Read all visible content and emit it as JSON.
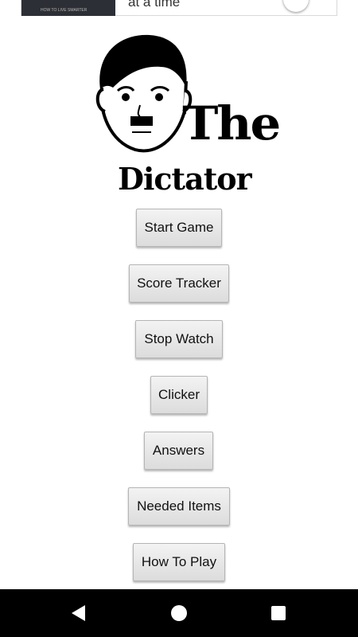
{
  "ad": {
    "thumb_caption": "HOW TO LIVE SMARTER",
    "text": "at a time"
  },
  "logo": {
    "title_the": "The",
    "title_dictator": "Dictator"
  },
  "menu": {
    "items": [
      {
        "label": "Start Game"
      },
      {
        "label": "Score Tracker"
      },
      {
        "label": "Stop Watch"
      },
      {
        "label": "Clicker"
      },
      {
        "label": "Answers"
      },
      {
        "label": "Needed Items"
      },
      {
        "label": "How To Play"
      }
    ]
  },
  "navbar": {
    "back_icon": "back-triangle-icon",
    "home_icon": "home-circle-icon",
    "recents_icon": "recents-square-icon"
  },
  "colors": {
    "background": "#ffffff",
    "navbar": "#000000",
    "button_top": "#f3f3f3",
    "button_bottom": "#dcdcdc"
  }
}
